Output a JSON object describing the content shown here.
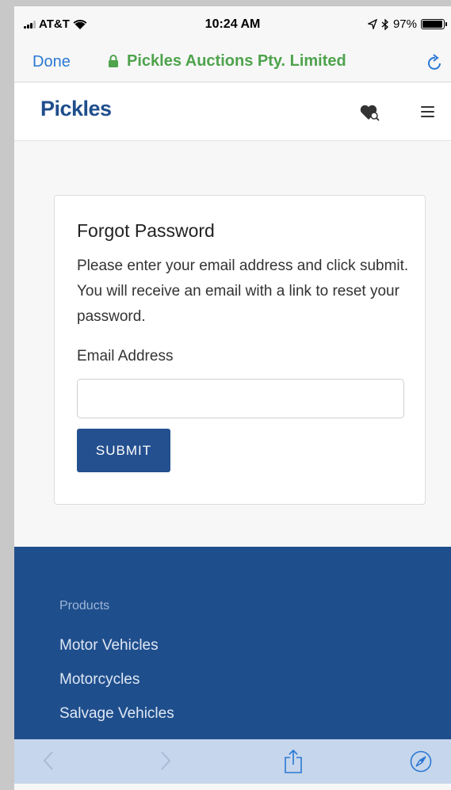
{
  "status_bar": {
    "carrier": "AT&T",
    "time": "10:24 AM",
    "battery": "97%",
    "battery_level": 0.97
  },
  "browser_nav": {
    "done_label": "Done",
    "site_title": "Pickles Auctions Pty. Limited",
    "title_color": "#4ea34c",
    "link_color": "#2a78d4"
  },
  "site_header": {
    "logo_text": "Pickles",
    "brand_color": "#1f4e8c"
  },
  "form": {
    "title": "Forgot Password",
    "description": "Please enter your email address and click submit. You will receive an email with a link to reset your password.",
    "email_label": "Email Address",
    "email_value": "",
    "email_placeholder": "",
    "submit_label": "SUBMIT"
  },
  "footer": {
    "heading": "Products",
    "links": [
      "Motor Vehicles",
      "Motorcycles",
      "Salvage Vehicles"
    ]
  },
  "toolbar": {
    "icons": [
      "back-icon",
      "forward-icon",
      "share-icon",
      "compass-icon"
    ]
  }
}
